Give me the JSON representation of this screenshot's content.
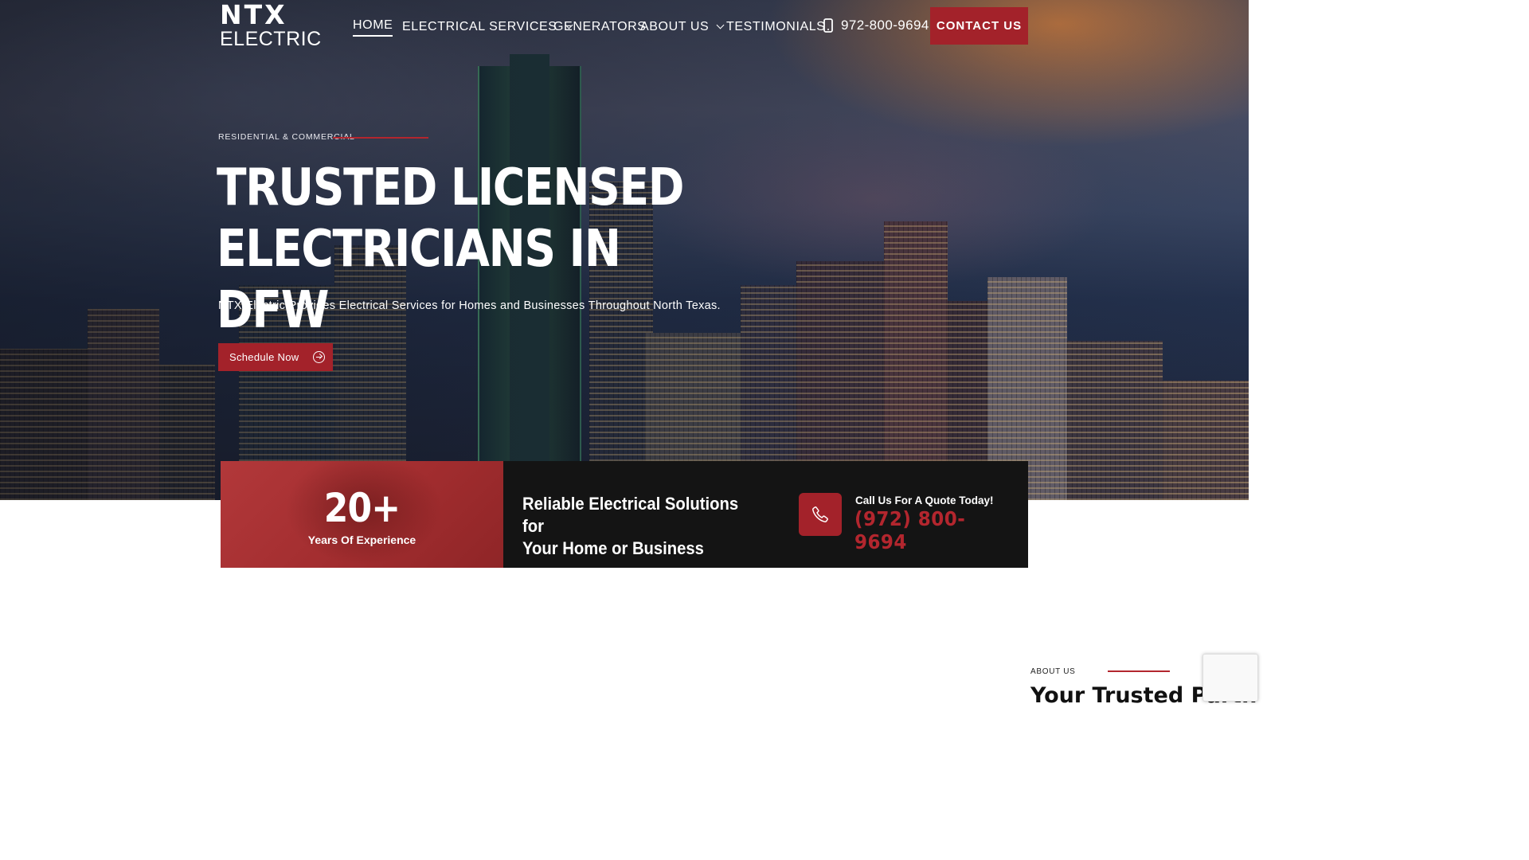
{
  "brand": {
    "logo_line1": "NTX",
    "logo_line2": "ELECTRIC"
  },
  "nav": {
    "items": [
      {
        "label": "HOME",
        "active": true,
        "dropdown": false
      },
      {
        "label": "ELECTRICAL SERVICES",
        "active": false,
        "dropdown": true
      },
      {
        "label": "GENERATORS",
        "active": false,
        "dropdown": false
      },
      {
        "label": "ABOUT US",
        "active": false,
        "dropdown": true
      },
      {
        "label": "TESTIMONIALS",
        "active": false,
        "dropdown": false
      }
    ],
    "phone": "972-800-9694",
    "contact_label": "CONTACT US"
  },
  "hero": {
    "eyebrow": "RESIDENTIAL & COMMERCIAL",
    "headline_line1": "TRUSTED LICENSED",
    "headline_line2": "ELECTRICIANS IN DFW",
    "subtitle": "NTX Electric Provides Electrical Services for Homes and Businesses Throughout North Texas.",
    "cta_label": "Schedule Now"
  },
  "stats": {
    "experience_value": "20+",
    "experience_label": "Years Of Experience",
    "tagline_line1": "Reliable Electrical Solutions for",
    "tagline_line2": "Your Home or Business",
    "call_label": "Call Us For A Quote Today!",
    "call_number": "(972) 800-9694"
  },
  "about": {
    "eyebrow": "ABOUT US",
    "title_partial": "Your Trusted Partn"
  },
  "colors": {
    "accent": "#a3222a",
    "dark": "#141414",
    "white": "#ffffff"
  },
  "icons": [
    "mobile-phone-icon",
    "chevron-down-icon",
    "arrow-circle-right-icon",
    "phone-icon"
  ]
}
